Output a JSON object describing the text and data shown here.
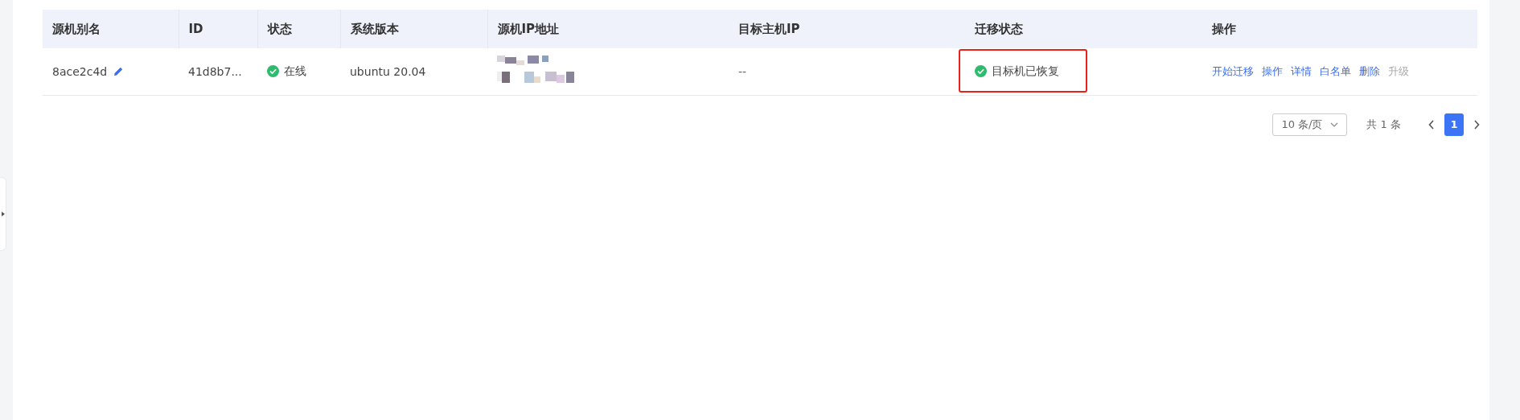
{
  "table": {
    "columns": [
      "源机别名",
      "ID",
      "状态",
      "系统版本",
      "源机IP地址",
      "目标主机IP",
      "迁移状态",
      "操作"
    ],
    "rows": [
      {
        "alias": "8ace2c4d",
        "id": "41d8b7...",
        "status": "在线",
        "os": "ubuntu 20.04",
        "target_ip": "--",
        "migration": {
          "label": "目标机已恢复",
          "highlighted": true
        },
        "actions": [
          {
            "label": "开始迁移",
            "disabled": false
          },
          {
            "label": "操作",
            "disabled": false
          },
          {
            "label": "详情",
            "disabled": false
          },
          {
            "label": "白名单",
            "disabled": false
          },
          {
            "label": "删除",
            "disabled": false
          },
          {
            "label": "升级",
            "disabled": true
          }
        ]
      }
    ]
  },
  "pagination": {
    "page_size": "10 条/页",
    "total": "共 1 条",
    "pages": [
      {
        "label": "1",
        "selected": true
      }
    ]
  }
}
